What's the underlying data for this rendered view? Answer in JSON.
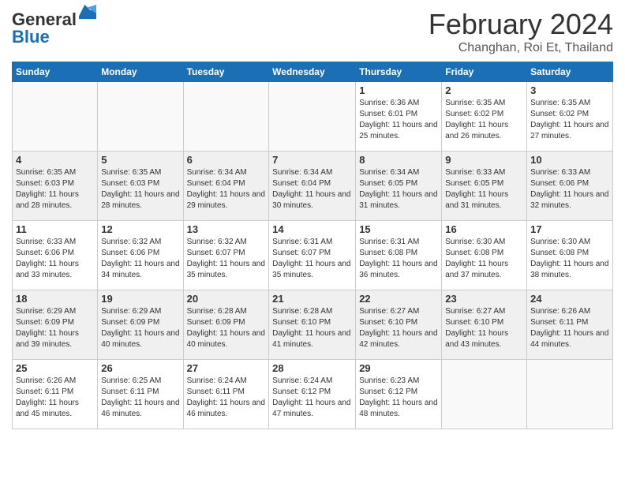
{
  "logo": {
    "line1": "General",
    "line2": "Blue"
  },
  "title": {
    "month_year": "February 2024",
    "location": "Changhan, Roi Et, Thailand"
  },
  "days_of_week": [
    "Sunday",
    "Monday",
    "Tuesday",
    "Wednesday",
    "Thursday",
    "Friday",
    "Saturday"
  ],
  "weeks": [
    [
      {
        "day": "",
        "info": ""
      },
      {
        "day": "",
        "info": ""
      },
      {
        "day": "",
        "info": ""
      },
      {
        "day": "",
        "info": ""
      },
      {
        "day": "1",
        "info": "Sunrise: 6:36 AM\nSunset: 6:01 PM\nDaylight: 11 hours and 25 minutes."
      },
      {
        "day": "2",
        "info": "Sunrise: 6:35 AM\nSunset: 6:02 PM\nDaylight: 11 hours and 26 minutes."
      },
      {
        "day": "3",
        "info": "Sunrise: 6:35 AM\nSunset: 6:02 PM\nDaylight: 11 hours and 27 minutes."
      }
    ],
    [
      {
        "day": "4",
        "info": "Sunrise: 6:35 AM\nSunset: 6:03 PM\nDaylight: 11 hours and 28 minutes."
      },
      {
        "day": "5",
        "info": "Sunrise: 6:35 AM\nSunset: 6:03 PM\nDaylight: 11 hours and 28 minutes."
      },
      {
        "day": "6",
        "info": "Sunrise: 6:34 AM\nSunset: 6:04 PM\nDaylight: 11 hours and 29 minutes."
      },
      {
        "day": "7",
        "info": "Sunrise: 6:34 AM\nSunset: 6:04 PM\nDaylight: 11 hours and 30 minutes."
      },
      {
        "day": "8",
        "info": "Sunrise: 6:34 AM\nSunset: 6:05 PM\nDaylight: 11 hours and 31 minutes."
      },
      {
        "day": "9",
        "info": "Sunrise: 6:33 AM\nSunset: 6:05 PM\nDaylight: 11 hours and 31 minutes."
      },
      {
        "day": "10",
        "info": "Sunrise: 6:33 AM\nSunset: 6:06 PM\nDaylight: 11 hours and 32 minutes."
      }
    ],
    [
      {
        "day": "11",
        "info": "Sunrise: 6:33 AM\nSunset: 6:06 PM\nDaylight: 11 hours and 33 minutes."
      },
      {
        "day": "12",
        "info": "Sunrise: 6:32 AM\nSunset: 6:06 PM\nDaylight: 11 hours and 34 minutes."
      },
      {
        "day": "13",
        "info": "Sunrise: 6:32 AM\nSunset: 6:07 PM\nDaylight: 11 hours and 35 minutes."
      },
      {
        "day": "14",
        "info": "Sunrise: 6:31 AM\nSunset: 6:07 PM\nDaylight: 11 hours and 35 minutes."
      },
      {
        "day": "15",
        "info": "Sunrise: 6:31 AM\nSunset: 6:08 PM\nDaylight: 11 hours and 36 minutes."
      },
      {
        "day": "16",
        "info": "Sunrise: 6:30 AM\nSunset: 6:08 PM\nDaylight: 11 hours and 37 minutes."
      },
      {
        "day": "17",
        "info": "Sunrise: 6:30 AM\nSunset: 6:08 PM\nDaylight: 11 hours and 38 minutes."
      }
    ],
    [
      {
        "day": "18",
        "info": "Sunrise: 6:29 AM\nSunset: 6:09 PM\nDaylight: 11 hours and 39 minutes."
      },
      {
        "day": "19",
        "info": "Sunrise: 6:29 AM\nSunset: 6:09 PM\nDaylight: 11 hours and 40 minutes."
      },
      {
        "day": "20",
        "info": "Sunrise: 6:28 AM\nSunset: 6:09 PM\nDaylight: 11 hours and 40 minutes."
      },
      {
        "day": "21",
        "info": "Sunrise: 6:28 AM\nSunset: 6:10 PM\nDaylight: 11 hours and 41 minutes."
      },
      {
        "day": "22",
        "info": "Sunrise: 6:27 AM\nSunset: 6:10 PM\nDaylight: 11 hours and 42 minutes."
      },
      {
        "day": "23",
        "info": "Sunrise: 6:27 AM\nSunset: 6:10 PM\nDaylight: 11 hours and 43 minutes."
      },
      {
        "day": "24",
        "info": "Sunrise: 6:26 AM\nSunset: 6:11 PM\nDaylight: 11 hours and 44 minutes."
      }
    ],
    [
      {
        "day": "25",
        "info": "Sunrise: 6:26 AM\nSunset: 6:11 PM\nDaylight: 11 hours and 45 minutes."
      },
      {
        "day": "26",
        "info": "Sunrise: 6:25 AM\nSunset: 6:11 PM\nDaylight: 11 hours and 46 minutes."
      },
      {
        "day": "27",
        "info": "Sunrise: 6:24 AM\nSunset: 6:11 PM\nDaylight: 11 hours and 46 minutes."
      },
      {
        "day": "28",
        "info": "Sunrise: 6:24 AM\nSunset: 6:12 PM\nDaylight: 11 hours and 47 minutes."
      },
      {
        "day": "29",
        "info": "Sunrise: 6:23 AM\nSunset: 6:12 PM\nDaylight: 11 hours and 48 minutes."
      },
      {
        "day": "",
        "info": ""
      },
      {
        "day": "",
        "info": ""
      }
    ]
  ]
}
